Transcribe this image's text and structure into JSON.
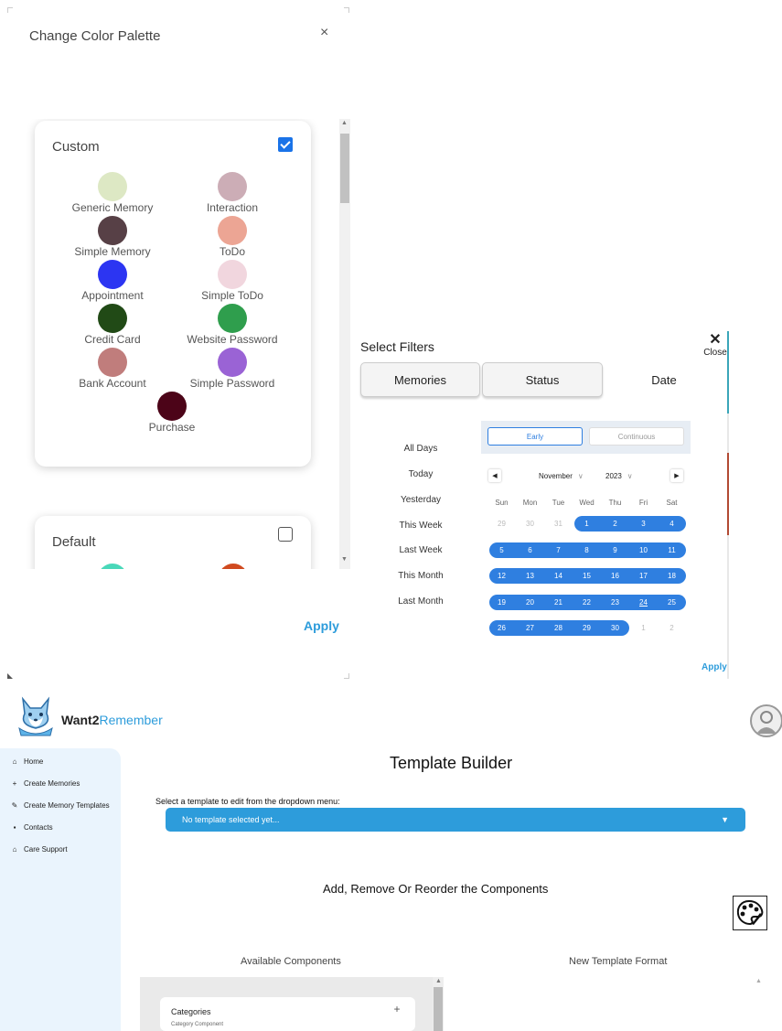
{
  "palette_modal": {
    "title": "Change Color Palette",
    "close_label": "×",
    "custom": {
      "title": "Custom",
      "checked": true,
      "swatches": [
        {
          "label": "Generic Memory",
          "color": "#dde8c4"
        },
        {
          "label": "Interaction",
          "color": "#ccadb6"
        },
        {
          "label": "Simple Memory",
          "color": "#574046"
        },
        {
          "label": "ToDo",
          "color": "#eca594"
        },
        {
          "label": "Appointment",
          "color": "#2c35f2"
        },
        {
          "label": "Simple ToDo",
          "color": "#f1d6de"
        },
        {
          "label": "Credit Card",
          "color": "#214a16"
        },
        {
          "label": "Website Password",
          "color": "#2f9e4d"
        },
        {
          "label": "Bank Account",
          "color": "#c07d7c"
        },
        {
          "label": "Simple Password",
          "color": "#9a63d5"
        },
        {
          "label": "Purchase",
          "color": "#4c0418"
        }
      ]
    },
    "default": {
      "title": "Default",
      "checked": false,
      "peek_colors": [
        "#49d8b9",
        "#d04a1f"
      ]
    },
    "apply_label": "Apply"
  },
  "filters": {
    "title": "Select Filters",
    "close_label": "Close",
    "tabs": [
      "Memories",
      "Status",
      "Date"
    ],
    "active_tab": "Date",
    "day_options": [
      "All Days",
      "Today",
      "Yesterday",
      "This Week",
      "Last Week",
      "This Month",
      "Last Month"
    ],
    "range_modes": [
      "Early",
      "Continuous"
    ],
    "selected_mode": "Early",
    "calendar": {
      "month": "November",
      "year": "2023",
      "weekdays": [
        "Sun",
        "Mon",
        "Tue",
        "Wed",
        "Thu",
        "Fri",
        "Sat"
      ],
      "today": "24",
      "weeks": [
        [
          "29",
          "30",
          "31",
          "1",
          "2",
          "3",
          "4"
        ],
        [
          "5",
          "6",
          "7",
          "8",
          "9",
          "10",
          "11"
        ],
        [
          "12",
          "13",
          "14",
          "15",
          "16",
          "17",
          "18"
        ],
        [
          "19",
          "20",
          "21",
          "22",
          "23",
          "24",
          "25"
        ],
        [
          "26",
          "27",
          "28",
          "29",
          "30",
          "1",
          "2"
        ]
      ],
      "selected_ranges": [
        [
          3,
          6
        ],
        [
          0,
          6
        ],
        [
          0,
          6
        ],
        [
          0,
          6
        ],
        [
          0,
          4
        ]
      ]
    },
    "apply_label": "Apply"
  },
  "app": {
    "brand_prefix": "Want2",
    "brand_suffix": "Remember",
    "accent_color": "#2d9cdb",
    "nav": [
      {
        "label": "Home",
        "icon": "home-icon",
        "glyph": "⌂"
      },
      {
        "label": "Create Memories",
        "icon": "plus-icon",
        "glyph": "+"
      },
      {
        "label": "Create Memory Templates",
        "icon": "pencil-icon",
        "glyph": "✎"
      },
      {
        "label": "Contacts",
        "icon": "contact-book-icon",
        "glyph": "▪"
      },
      {
        "label": "Care Support",
        "icon": "care-home-icon",
        "glyph": "⌂"
      }
    ],
    "page_title": "Template Builder",
    "template_select_label": "Select a template to edit from the dropdown menu:",
    "template_select_value": "No template selected yet...",
    "components_heading": "Add, Remove Or Reorder the Components",
    "available_title": "Available Components",
    "new_format_title": "New Template Format",
    "components": [
      {
        "name": "Categories",
        "description": "Category Component"
      }
    ]
  }
}
